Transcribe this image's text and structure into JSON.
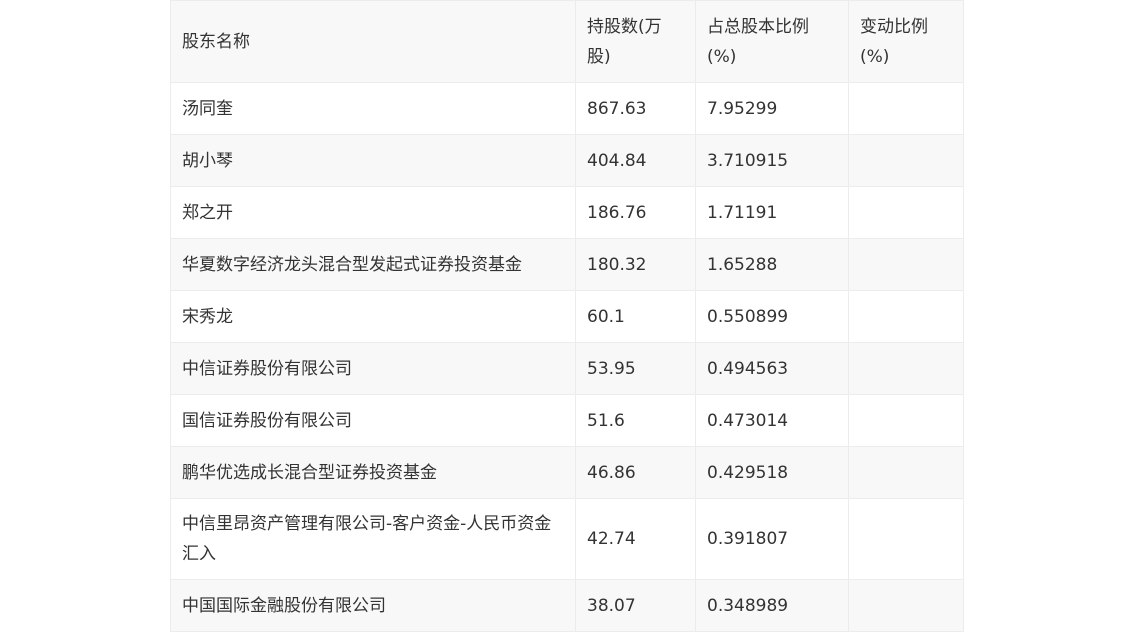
{
  "table": {
    "headers": [
      "股东名称",
      "持股数(万股)",
      "占总股本比例(%)",
      "变动比例(%)"
    ],
    "rows": [
      {
        "name": "汤同奎",
        "shares": "867.63",
        "ratio": "7.95299",
        "change": ""
      },
      {
        "name": "胡小琴",
        "shares": "404.84",
        "ratio": "3.710915",
        "change": ""
      },
      {
        "name": "郑之开",
        "shares": "186.76",
        "ratio": "1.71191",
        "change": ""
      },
      {
        "name": "华夏数字经济龙头混合型发起式证券投资基金",
        "shares": "180.32",
        "ratio": "1.65288",
        "change": ""
      },
      {
        "name": "宋秀龙",
        "shares": "60.1",
        "ratio": "0.550899",
        "change": ""
      },
      {
        "name": "中信证券股份有限公司",
        "shares": "53.95",
        "ratio": "0.494563",
        "change": ""
      },
      {
        "name": "国信证券股份有限公司",
        "shares": "51.6",
        "ratio": "0.473014",
        "change": ""
      },
      {
        "name": "鹏华优选成长混合型证券投资基金",
        "shares": "46.86",
        "ratio": "0.429518",
        "change": ""
      },
      {
        "name": "中信里昂资产管理有限公司-客户资金-人民币资金汇入",
        "shares": "42.74",
        "ratio": "0.391807",
        "change": ""
      },
      {
        "name": "中国国际金融股份有限公司",
        "shares": "38.07",
        "ratio": "0.348989",
        "change": ""
      }
    ]
  }
}
